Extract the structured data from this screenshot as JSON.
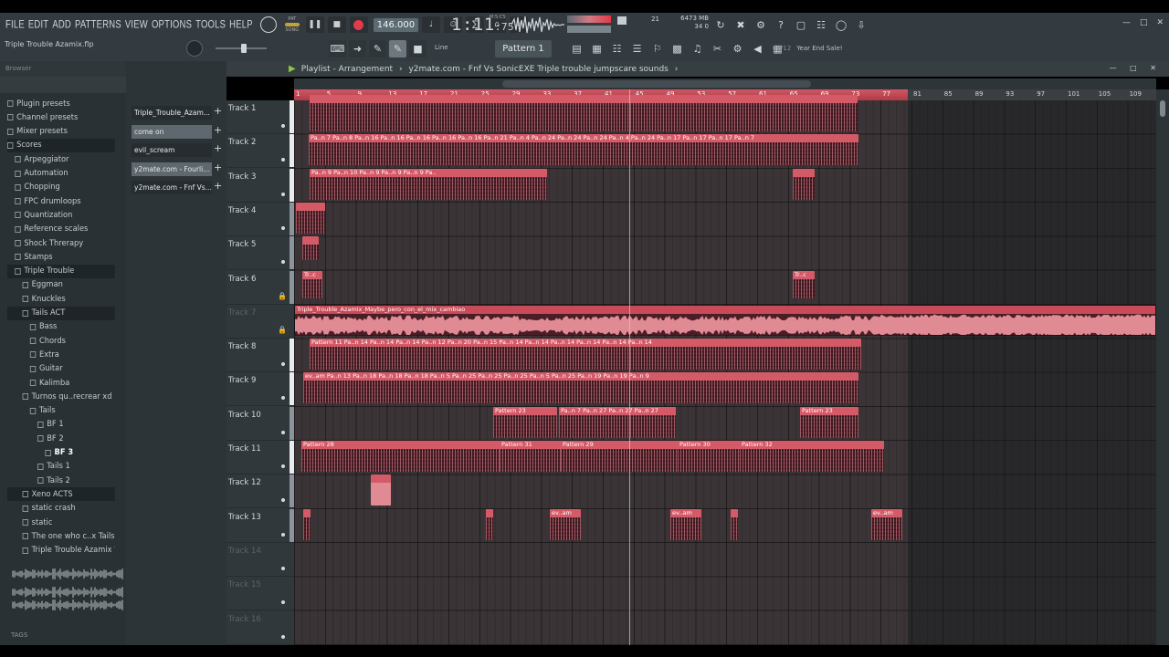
{
  "menu": [
    "FILE",
    "EDIT",
    "ADD",
    "PATTERNS",
    "VIEW",
    "OPTIONS",
    "TOOLS",
    "HELP"
  ],
  "transport": {
    "mode_pat": "PAT",
    "mode_song": "SONG",
    "tempo": "146.000",
    "time_main": "1:11",
    "time_sub": "75",
    "time_unit": "M:S:CS"
  },
  "monitor": {
    "cpu_value": "21",
    "cpu_sub": "34",
    "mem": "6473 MB",
    "mem_sub": "0"
  },
  "project_name": "Triple Trouble Azamix.flp",
  "toolbar": {
    "snap": "Line",
    "pattern": "Pattern 1",
    "news_count": "02/12",
    "news_text": "Year End Sale!"
  },
  "browser": {
    "title": "Browser",
    "items": [
      {
        "label": "Plugin presets",
        "indent": 0
      },
      {
        "label": "Channel presets",
        "indent": 0
      },
      {
        "label": "Mixer presets",
        "indent": 0
      },
      {
        "label": "Scores",
        "indent": 0
      },
      {
        "label": "Arpeggiator",
        "indent": 1
      },
      {
        "label": "Automation",
        "indent": 1
      },
      {
        "label": "Chopping",
        "indent": 1
      },
      {
        "label": "FPC drumloops",
        "indent": 1
      },
      {
        "label": "Quantization",
        "indent": 1
      },
      {
        "label": "Reference scales",
        "indent": 1
      },
      {
        "label": "Shock Threrapy",
        "indent": 1
      },
      {
        "label": "Stamps",
        "indent": 1
      },
      {
        "label": "Triple Trouble",
        "indent": 1
      },
      {
        "label": "Eggman",
        "indent": 2
      },
      {
        "label": "Knuckles",
        "indent": 2
      },
      {
        "label": "Tails ACT",
        "indent": 2
      },
      {
        "label": "Bass",
        "indent": 3
      },
      {
        "label": "Chords",
        "indent": 3
      },
      {
        "label": "Extra",
        "indent": 3
      },
      {
        "label": "Guitar",
        "indent": 3
      },
      {
        "label": "Kalimba",
        "indent": 3
      },
      {
        "label": "Turnos qu..recrear xd",
        "indent": 2
      },
      {
        "label": "Tails",
        "indent": 3
      },
      {
        "label": "BF 1",
        "indent": 4
      },
      {
        "label": "BF 2",
        "indent": 4
      },
      {
        "label": "BF 3",
        "indent": 5
      },
      {
        "label": "Tails 1",
        "indent": 4
      },
      {
        "label": "Tails 2",
        "indent": 4
      },
      {
        "label": "Xeno ACTS",
        "indent": 2
      },
      {
        "label": "static crash",
        "indent": 2
      },
      {
        "label": "static",
        "indent": 2
      },
      {
        "label": "The one who c..x Tails Part",
        "indent": 2
      },
      {
        "label": "Triple Trouble Azamix WIP",
        "indent": 2
      }
    ],
    "tags_label": "TAGS"
  },
  "channels": [
    "Triple_Trouble_Azam...",
    "come on",
    "evil_scream",
    "y2mate.com - Fourli...",
    "y2mate.com - Fnf Vs..."
  ],
  "playlist": {
    "title": "Playlist - Arrangement",
    "crumb1": "y2mate.com - Fnf Vs SonicEXE  Triple trouble jumpscare sounds",
    "bars": [
      "1",
      "5",
      "9",
      "13",
      "17",
      "21",
      "25",
      "29",
      "33",
      "37",
      "41",
      "45",
      "49",
      "53",
      "57",
      "61",
      "65",
      "69",
      "73",
      "77",
      "81",
      "85",
      "89",
      "93",
      "97",
      "101",
      "105",
      "109"
    ],
    "tracks": [
      "Track 1",
      "Track 2",
      "Track 3",
      "Track 4",
      "Track 5",
      "Track 6",
      "Track 7",
      "Track 8",
      "Track 9",
      "Track 10",
      "Track 11",
      "Track 12",
      "Track 13",
      "Track 14",
      "Track 15",
      "Track 16"
    ],
    "audio_clip": "Triple_Trouble_Azamix_Maybe_pero_con_el_mix_cambiao",
    "clip_labels": {
      "t2": "Pa..n 7  Pa..n 8  Pa..n 16  Pa..n 16  Pa..n 16  Pa..n 16  Pa..n 16  Pa..n 21  Pa..n 4  Pa..n 24  Pa..n 24  Pa..n 24  Pa..n 4  Pa..n 24  Pa..n 17  Pa..n 17  Pa..n 17  Pa..n 7",
      "t3": "Pa..n 9  Pa..n 10  Pa..n 9  Pa..n 9  Pa..n 9  Pa..",
      "t8": "Pattern 11  Pa..n 14  Pa..n 14  Pa..n 14  Pa..n 12  Pa..n 20  Pa..n 15  Pa..n 14  Pa..n 14  Pa..n 14  Pa..n 14  Pa..n 14  Pa..n 14",
      "t9": "ev..am  Pa..n 13  Pa..n 18  Pa..n 18  Pa..n 18  Pa..n 5  Pa..n 25  Pa..n 25  Pa..n 25  Pa..n 5  Pa..n 25  Pa..n 19  Pa..n 19  Pa..n 9",
      "t10a": "Pattern 23",
      "t10b": "Pa..n 7  Pa..n 27  Pa..n 27  Pa..n 27",
      "t10c": "Pattern 23",
      "t11a": "Pattern 28",
      "t11b": "Pattern 31",
      "t11c": "Pattern 29",
      "t11d": "Pattern 30",
      "t11e": "Pattern 32",
      "ev": "ev..am",
      "t6": "Tr..c"
    }
  }
}
